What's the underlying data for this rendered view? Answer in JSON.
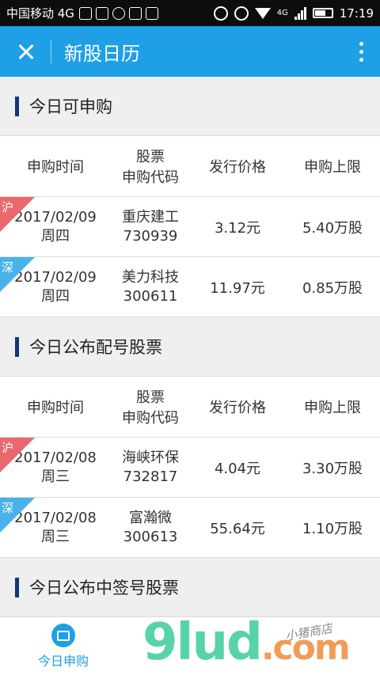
{
  "status": {
    "carrier": "中国移动 4G",
    "network": "4G",
    "time": "17:19"
  },
  "appbar": {
    "title": "新股日历"
  },
  "columns": {
    "date": "申购时间",
    "code_line1": "股票",
    "code_line2": "申购代码",
    "price": "发行价格",
    "limit": "申购上限"
  },
  "sections": [
    {
      "title": "今日可申购",
      "rows": [
        {
          "tag": "沪",
          "date": "2017/02/09",
          "weekday": "周四",
          "name": "重庆建工",
          "code": "730939",
          "price": "3.12元",
          "limit": "5.40万股"
        },
        {
          "tag": "深",
          "date": "2017/02/09",
          "weekday": "周四",
          "name": "美力科技",
          "code": "300611",
          "price": "11.97元",
          "limit": "0.85万股"
        }
      ]
    },
    {
      "title": "今日公布配号股票",
      "rows": [
        {
          "tag": "沪",
          "date": "2017/02/08",
          "weekday": "周三",
          "name": "海峡环保",
          "code": "732817",
          "price": "4.04元",
          "limit": "3.30万股"
        },
        {
          "tag": "深",
          "date": "2017/02/08",
          "weekday": "周三",
          "name": "富瀚微",
          "code": "300613",
          "price": "55.64元",
          "limit": "1.10万股"
        }
      ]
    },
    {
      "title": "今日公布中签号股票"
    }
  ],
  "bottom_nav": {
    "tab_label": "今日申购"
  },
  "watermark": {
    "text": "9lud",
    "suffix": ".com",
    "sub": "小猪商店"
  }
}
